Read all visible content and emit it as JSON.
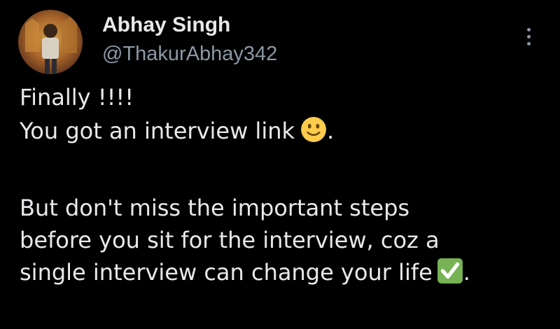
{
  "author": {
    "display_name": "Abhay Singh",
    "handle": "@ThakurAbhay342"
  },
  "tweet": {
    "line1": "Finally !!!!",
    "line2_before": "You got an interview link",
    "line2_after": ".",
    "line3": "But don't miss the important steps",
    "line4": "before you sit for the interview, coz a",
    "line5_before": "single interview can change your life",
    "line5_after": "."
  },
  "icons": {
    "more": "more-options-icon",
    "smile": "slightly-smiling-face-emoji",
    "check": "check-mark-button-emoji"
  },
  "colors": {
    "background": "#000000",
    "primary_text": "#e7e9ea",
    "secondary_text": "#8b98a5",
    "check_green": "#77b255",
    "smile_yellow": "#ffcc4d"
  }
}
